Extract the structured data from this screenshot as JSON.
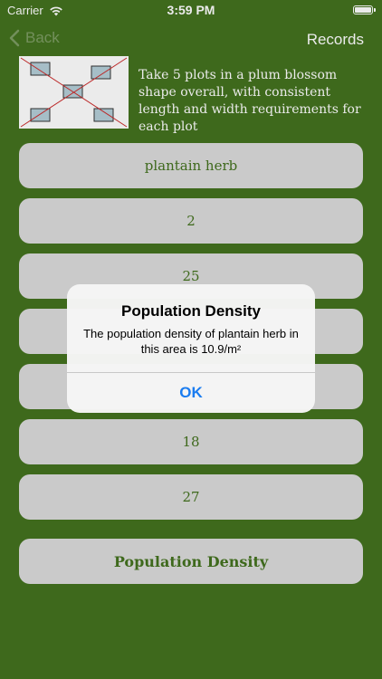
{
  "status_bar": {
    "carrier": "Carrier",
    "time": "3:59 PM"
  },
  "nav": {
    "back_label": "Back",
    "right_label": "Records"
  },
  "header": {
    "image_icon": "plum-blossom-plot-diagram",
    "description": "Take 5 plots in a plum blossom shape overall, with consistent length and width requirements for each plot"
  },
  "fields": [
    "plantain herb",
    "2",
    "25",
    "",
    "",
    "18",
    "27"
  ],
  "action_button": "Population Density",
  "alert": {
    "title": "Population Density",
    "message": "The population density of plantain herb in this area is 10.9/m²",
    "button": "OK"
  },
  "colors": {
    "background": "#44721f",
    "pill": "#dcdcdc",
    "accent": "#1a7cf0"
  }
}
